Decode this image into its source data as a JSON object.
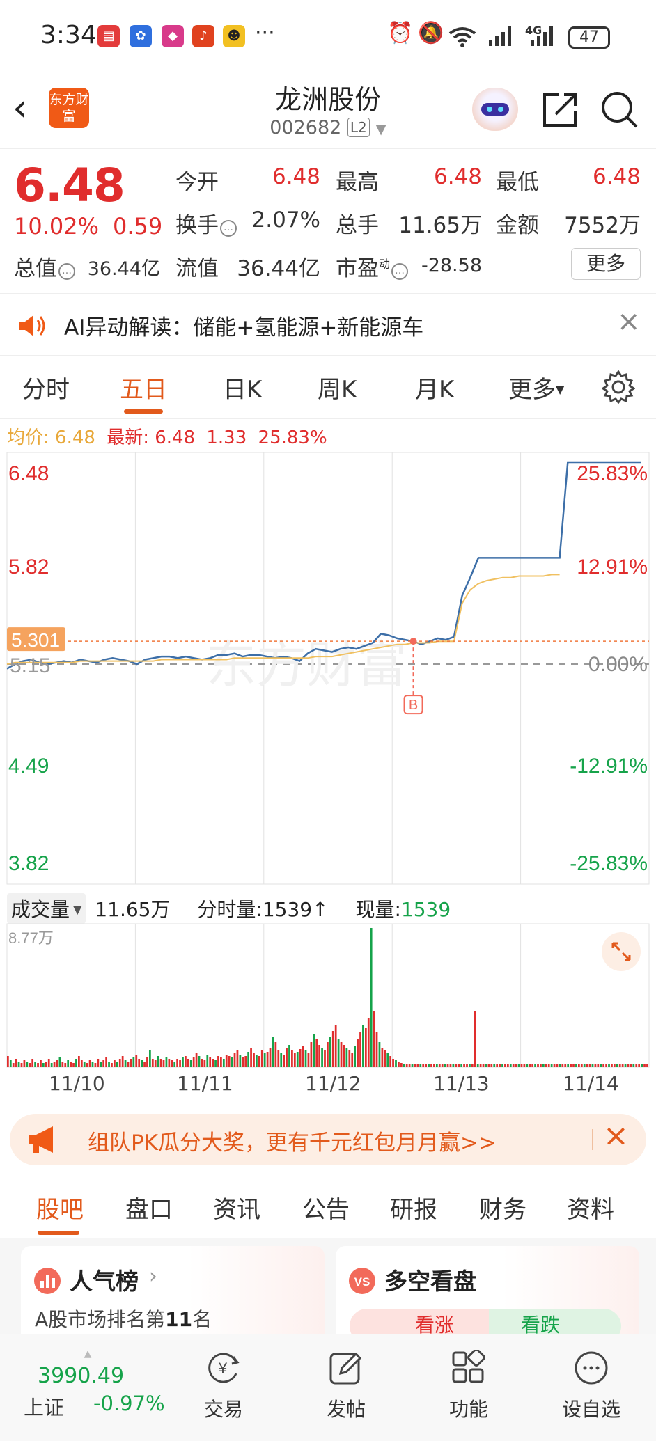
{
  "status_bar": {
    "time": "3:34",
    "more": "···",
    "network": "4G",
    "battery": "47"
  },
  "header": {
    "logo_text": "东方财富",
    "stock_name": "龙洲股份",
    "stock_code": "002682",
    "level_badge": "L2"
  },
  "quote": {
    "price": "6.48",
    "change_pct": "10.02%",
    "change_amt": "0.59",
    "open_label": "今开",
    "open_value": "6.48",
    "high_label": "最高",
    "high_value": "6.48",
    "low_label": "最低",
    "low_value": "6.48",
    "turnover_label": "换手",
    "turnover_value": "2.07%",
    "volume_label": "总手",
    "volume_value": "11.65万",
    "amount_label": "金额",
    "amount_value": "7552万",
    "mktcap_label": "总值",
    "mktcap_value": "36.44亿",
    "float_label": "流值",
    "float_value": "36.44亿",
    "pe_label": "市盈",
    "pe_sup": "动",
    "pe_value": "-28.58",
    "more_button": "更多"
  },
  "ai_bar": {
    "text": "AI异动解读：储能+氢能源+新能源车"
  },
  "chart_tabs": [
    "分时",
    "五日",
    "日K",
    "周K",
    "月K",
    "更多"
  ],
  "chart_legend": {
    "avg_label": "均价:",
    "avg_value": "6.48",
    "latest_label": "最新:",
    "latest_value": "6.48",
    "latest_change": "1.33",
    "latest_pct": "25.83%"
  },
  "colors": {
    "accent": "#e25a1c",
    "up": "#e02d2d",
    "down": "#16a34a",
    "price_line": "#3d6fa8",
    "avg_line": "#f0c060"
  },
  "chart_data": {
    "type": "line",
    "x": [
      "11/10",
      "11/11",
      "11/12",
      "11/13",
      "11/14"
    ],
    "ylim": [
      3.82,
      6.48
    ],
    "y_ticks_left": [
      "6.48",
      "5.82",
      "4.49",
      "3.82"
    ],
    "y_ticks_right": [
      "25.83%",
      "12.91%",
      "0.00%",
      "-12.91%",
      "-25.83%"
    ],
    "base_price_label": "5.15",
    "crosshair_label": "5.301",
    "buy_marker": "B",
    "watermark": "东方财富",
    "series": [
      {
        "values": [
          5.12,
          5.15,
          5.17,
          5.18,
          5.16,
          5.15,
          5.16,
          5.17,
          5.16,
          5.18,
          5.17,
          5.16,
          5.18,
          5.19,
          5.18,
          5.17,
          5.15,
          5.18,
          5.19,
          5.2,
          5.2,
          5.19,
          5.2,
          5.19,
          5.18,
          5.19,
          5.21,
          5.21,
          5.22,
          5.2,
          5.21,
          5.21,
          5.2,
          5.19,
          5.2,
          5.19,
          5.17,
          5.22,
          5.25,
          5.24,
          5.23,
          5.25,
          5.26,
          5.25,
          5.27,
          5.29,
          5.35,
          5.34,
          5.32,
          5.31,
          5.3,
          5.28,
          5.3,
          5.32,
          5.31,
          5.33,
          5.6,
          5.72,
          5.85,
          5.85,
          5.85,
          5.85,
          5.85,
          5.85,
          5.85,
          5.85,
          5.85,
          5.85,
          5.85,
          6.48,
          6.48,
          6.48,
          6.48,
          6.48,
          6.48,
          6.48,
          6.48,
          6.48,
          6.48
        ]
      },
      {
        "values": [
          5.15,
          5.16,
          5.16,
          5.16,
          5.16,
          5.16,
          5.16,
          5.16,
          5.16,
          5.17,
          5.17,
          5.17,
          5.17,
          5.17,
          5.17,
          5.17,
          5.17,
          5.17,
          5.17,
          5.18,
          5.18,
          5.18,
          5.18,
          5.18,
          5.18,
          5.18,
          5.18,
          5.18,
          5.19,
          5.19,
          5.19,
          5.19,
          5.19,
          5.19,
          5.19,
          5.19,
          5.19,
          5.19,
          5.2,
          5.2,
          5.2,
          5.21,
          5.22,
          5.23,
          5.24,
          5.25,
          5.26,
          5.27,
          5.28,
          5.28,
          5.29,
          5.29,
          5.29,
          5.3,
          5.3,
          5.3,
          5.55,
          5.64,
          5.68,
          5.7,
          5.71,
          5.72,
          5.72,
          5.73,
          5.73,
          5.73,
          5.73,
          5.74,
          5.74
        ]
      }
    ]
  },
  "volume": {
    "selector": "成交量",
    "total": "11.65万",
    "tick_label": "分时量:1539↑",
    "current_label": "现量:",
    "current_value": "1539",
    "max_label": "8.77万",
    "bars": [
      8,
      5,
      3,
      6,
      4,
      3,
      5,
      4,
      3,
      6,
      4,
      3,
      5,
      3,
      4,
      6,
      3,
      4,
      5,
      7,
      4,
      3,
      5,
      4,
      3,
      6,
      8,
      5,
      4,
      3,
      5,
      4,
      3,
      6,
      4,
      5,
      7,
      4,
      3,
      5,
      4,
      6,
      8,
      5,
      4,
      6,
      7,
      9,
      6,
      5,
      4,
      7,
      12,
      6,
      5,
      8,
      6,
      5,
      7,
      6,
      5,
      4,
      6,
      5,
      7,
      8,
      6,
      5,
      7,
      10,
      8,
      6,
      5,
      9,
      7,
      6,
      5,
      8,
      7,
      6,
      9,
      8,
      7,
      10,
      12,
      9,
      7,
      8,
      11,
      14,
      10,
      9,
      8,
      12,
      10,
      11,
      14,
      22,
      18,
      12,
      10,
      9,
      14,
      16,
      12,
      10,
      11,
      13,
      15,
      12,
      10,
      18,
      24,
      20,
      16,
      14,
      12,
      18,
      22,
      26,
      30,
      20,
      18,
      16,
      14,
      12,
      10,
      15,
      20,
      25,
      30,
      28,
      35,
      100,
      40,
      25,
      18,
      14,
      12,
      10,
      8,
      6,
      5,
      4,
      3,
      2,
      2,
      2,
      2,
      2,
      2,
      2,
      2,
      2,
      2,
      2,
      2,
      2,
      2,
      2,
      2,
      2,
      2,
      2,
      2,
      2,
      2,
      2,
      2,
      2,
      2,
      40,
      2,
      2,
      2,
      2,
      2,
      2,
      2,
      2,
      2,
      2,
      2,
      2,
      2,
      2,
      2,
      2,
      2,
      2,
      2,
      2,
      2,
      2,
      2,
      2,
      2,
      2,
      2,
      2,
      2,
      2,
      2,
      2,
      2,
      2,
      2,
      2,
      2,
      2,
      2,
      2,
      2,
      2,
      2,
      2,
      2,
      2,
      2,
      2,
      2,
      2,
      2,
      2,
      2,
      2,
      2,
      2,
      2,
      2,
      2,
      2,
      2,
      2,
      2
    ]
  },
  "promo": {
    "text": "组队PK瓜分大奖，更有千元红包月月赢>>"
  },
  "sub_tabs": [
    "股吧",
    "盘口",
    "资讯",
    "公告",
    "研报",
    "财务",
    "资料"
  ],
  "cards": {
    "popularity_title": "人气榜",
    "popularity_desc_prefix": "A股市场排名第",
    "popularity_rank": "11",
    "popularity_desc_suffix": "名",
    "bullbear_title": "多空看盘",
    "bull_label": "看涨",
    "bear_label": "看跌"
  },
  "bottom_nav": {
    "index_value": "3990.49",
    "index_name": "上证",
    "index_change": "-0.97%",
    "trade": "交易",
    "post": "发帖",
    "functions": "功能",
    "watchlist": "设自选"
  }
}
